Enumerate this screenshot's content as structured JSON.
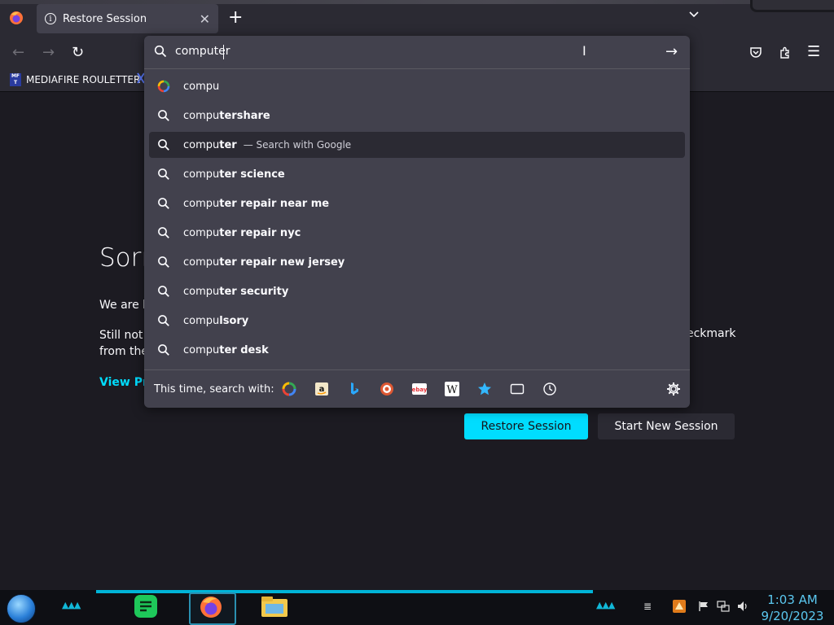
{
  "tabs": [
    {
      "title": "Restore Session",
      "close_glyph": "✕"
    }
  ],
  "tabbar": {
    "new_tab_glyph": "+",
    "list_glyph": "⌄"
  },
  "navbar": {
    "back_glyph": "←",
    "forward_glyph": "→",
    "reload_glyph": "↻",
    "pocket_icon": "pocket-icon",
    "extensions_icon": "extensions-icon",
    "menu_glyph": "☰"
  },
  "bookmarks": [
    {
      "label": "MEDIAFIRE ROULETTER",
      "icon_text": "MF T"
    }
  ],
  "urlbar": {
    "value": "computer",
    "go_glyph": "→",
    "ibeam_glyph": "I",
    "results": [
      {
        "type": "google",
        "typed": "compu",
        "rest": "",
        "note": ""
      },
      {
        "type": "search",
        "typed": "compu",
        "rest": "tershare",
        "note": ""
      },
      {
        "type": "search",
        "typed": "compu",
        "rest": "ter",
        "note": "— Search with Google",
        "selected": true
      },
      {
        "type": "search",
        "typed": "compu",
        "rest": "ter science",
        "note": ""
      },
      {
        "type": "search",
        "typed": "compu",
        "rest": "ter repair near me",
        "note": ""
      },
      {
        "type": "search",
        "typed": "compu",
        "rest": "ter repair nyc",
        "note": ""
      },
      {
        "type": "search",
        "typed": "compu",
        "rest": "ter repair new jersey",
        "note": ""
      },
      {
        "type": "search",
        "typed": "compu",
        "rest": "ter security",
        "note": ""
      },
      {
        "type": "search",
        "typed": "compu",
        "rest": "lsory",
        "note": ""
      },
      {
        "type": "search",
        "typed": "compu",
        "rest": "ter desk",
        "note": ""
      }
    ],
    "oneoff_label": "This time, search with:",
    "engines": [
      "google-icon",
      "amazon-icon",
      "bing-icon",
      "duckduckgo-icon",
      "ebay-icon",
      "wikipedia-icon",
      "bookmarks-icon",
      "tabs-icon",
      "history-icon"
    ]
  },
  "page": {
    "heading": "Sorr",
    "para1": "We are h",
    "para2_line1": "Still not",
    "para2_line2": "from the",
    "para2_right": "eckmark",
    "view_link": "View Pro",
    "restore_button": "Restore Session",
    "new_session_button": "Start New Session"
  },
  "taskbar": {
    "time": "1:03 AM",
    "date": "9/20/2023"
  },
  "colors": {
    "accent": "#00ddff",
    "panel": "#42414d",
    "chrome": "#2b2a33",
    "page_bg": "#1c1b22"
  }
}
